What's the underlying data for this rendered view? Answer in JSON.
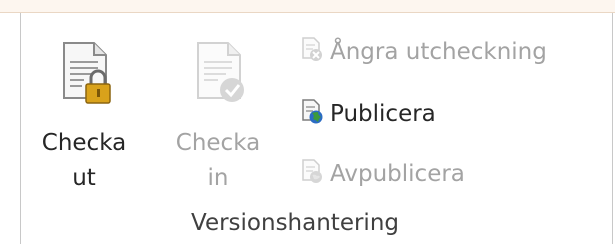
{
  "ribbon_group": {
    "label": "Versionshantering",
    "buttons": {
      "check_out": {
        "label_line1": "Checka",
        "label_line2": "ut",
        "icon": "document-lock-icon",
        "enabled": true
      },
      "check_in": {
        "label_line1": "Checka",
        "label_line2": "in",
        "icon": "document-check-icon",
        "enabled": false
      },
      "undo_checkout": {
        "label": "Ångra utcheckning",
        "icon": "document-undo-icon",
        "enabled": false
      },
      "publish": {
        "label": "Publicera",
        "icon": "document-publish-icon",
        "enabled": true
      },
      "unpublish": {
        "label": "Avpublicera",
        "icon": "document-unpublish-icon",
        "enabled": false
      }
    }
  },
  "colors": {
    "text_enabled": "#262626",
    "text_disabled": "#a3a3a3",
    "lock_gold": "#d9a21b",
    "globe_green": "#3c9a3a",
    "globe_blue": "#2b6cc4"
  }
}
